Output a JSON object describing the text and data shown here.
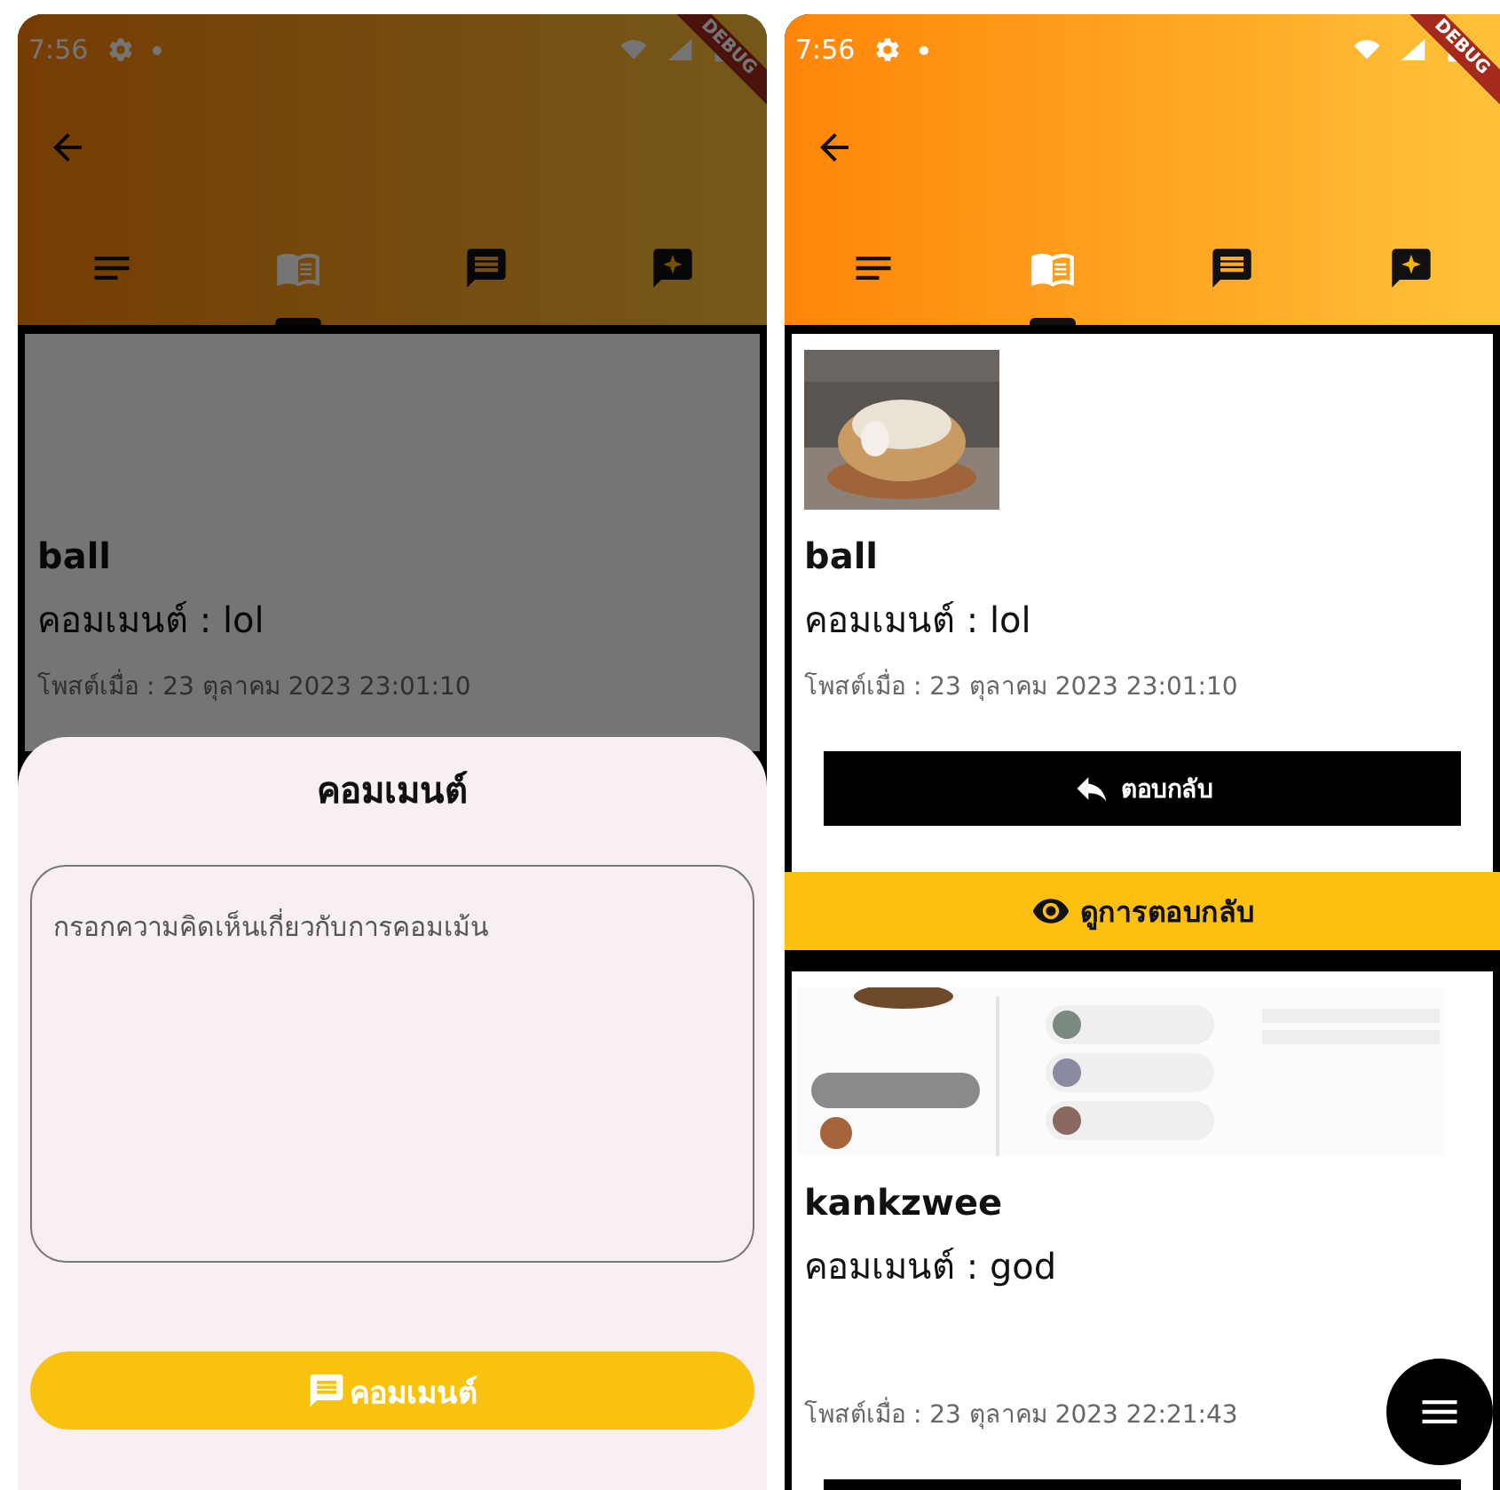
{
  "screens": [
    {
      "status_bar": {
        "time": "7:56",
        "debug_banner": "DEBUG"
      },
      "dimmed": true,
      "tabs": [
        {
          "kind": "list",
          "selected": false
        },
        {
          "kind": "book",
          "selected": true
        },
        {
          "kind": "chat",
          "selected": false
        },
        {
          "kind": "chat-add",
          "selected": false
        }
      ],
      "posts": [
        {
          "author": "ball",
          "comment": "คอมเมนต์ : lol",
          "posted": "โพสต์เมื่อ : 23 ตุลาคม 2023 23:01:10"
        }
      ],
      "comment_sheet": {
        "title": "คอมเมนต์",
        "placeholder": "กรอกความคิดเห็นเกี่ยวกับการคอมเม้น",
        "submit_label": "คอมเมนต์"
      },
      "has_menu_button": false
    },
    {
      "status_bar": {
        "time": "7:56",
        "debug_banner": "DEBUG"
      },
      "dimmed": false,
      "tabs": [
        {
          "kind": "list",
          "selected": false
        },
        {
          "kind": "book",
          "selected": true
        },
        {
          "kind": "chat",
          "selected": false
        },
        {
          "kind": "chat-add",
          "selected": false
        }
      ],
      "posts": [
        {
          "author": "ball",
          "comment": "คอมเมนต์ : lol",
          "posted": "โพสต์เมื่อ : 23 ตุลาคม 2023 23:01:10",
          "image": {
            "kind": "picture"
          },
          "actions": [
            {
              "kind": "reply",
              "label": "ตอบกลับ"
            },
            {
              "kind": "view",
              "label": "ดูการตอบกลับ"
            }
          ]
        },
        {
          "author": "kankzwee",
          "comment": "คอมเมนต์ : god",
          "posted": "โพสต์เมื่อ : 23 ตุลาคม 2023 22:21:43",
          "image": {
            "kind": "picture"
          },
          "actions": [
            {
              "kind": "reply"
            }
          ]
        }
      ],
      "has_menu_button": true
    }
  ]
}
